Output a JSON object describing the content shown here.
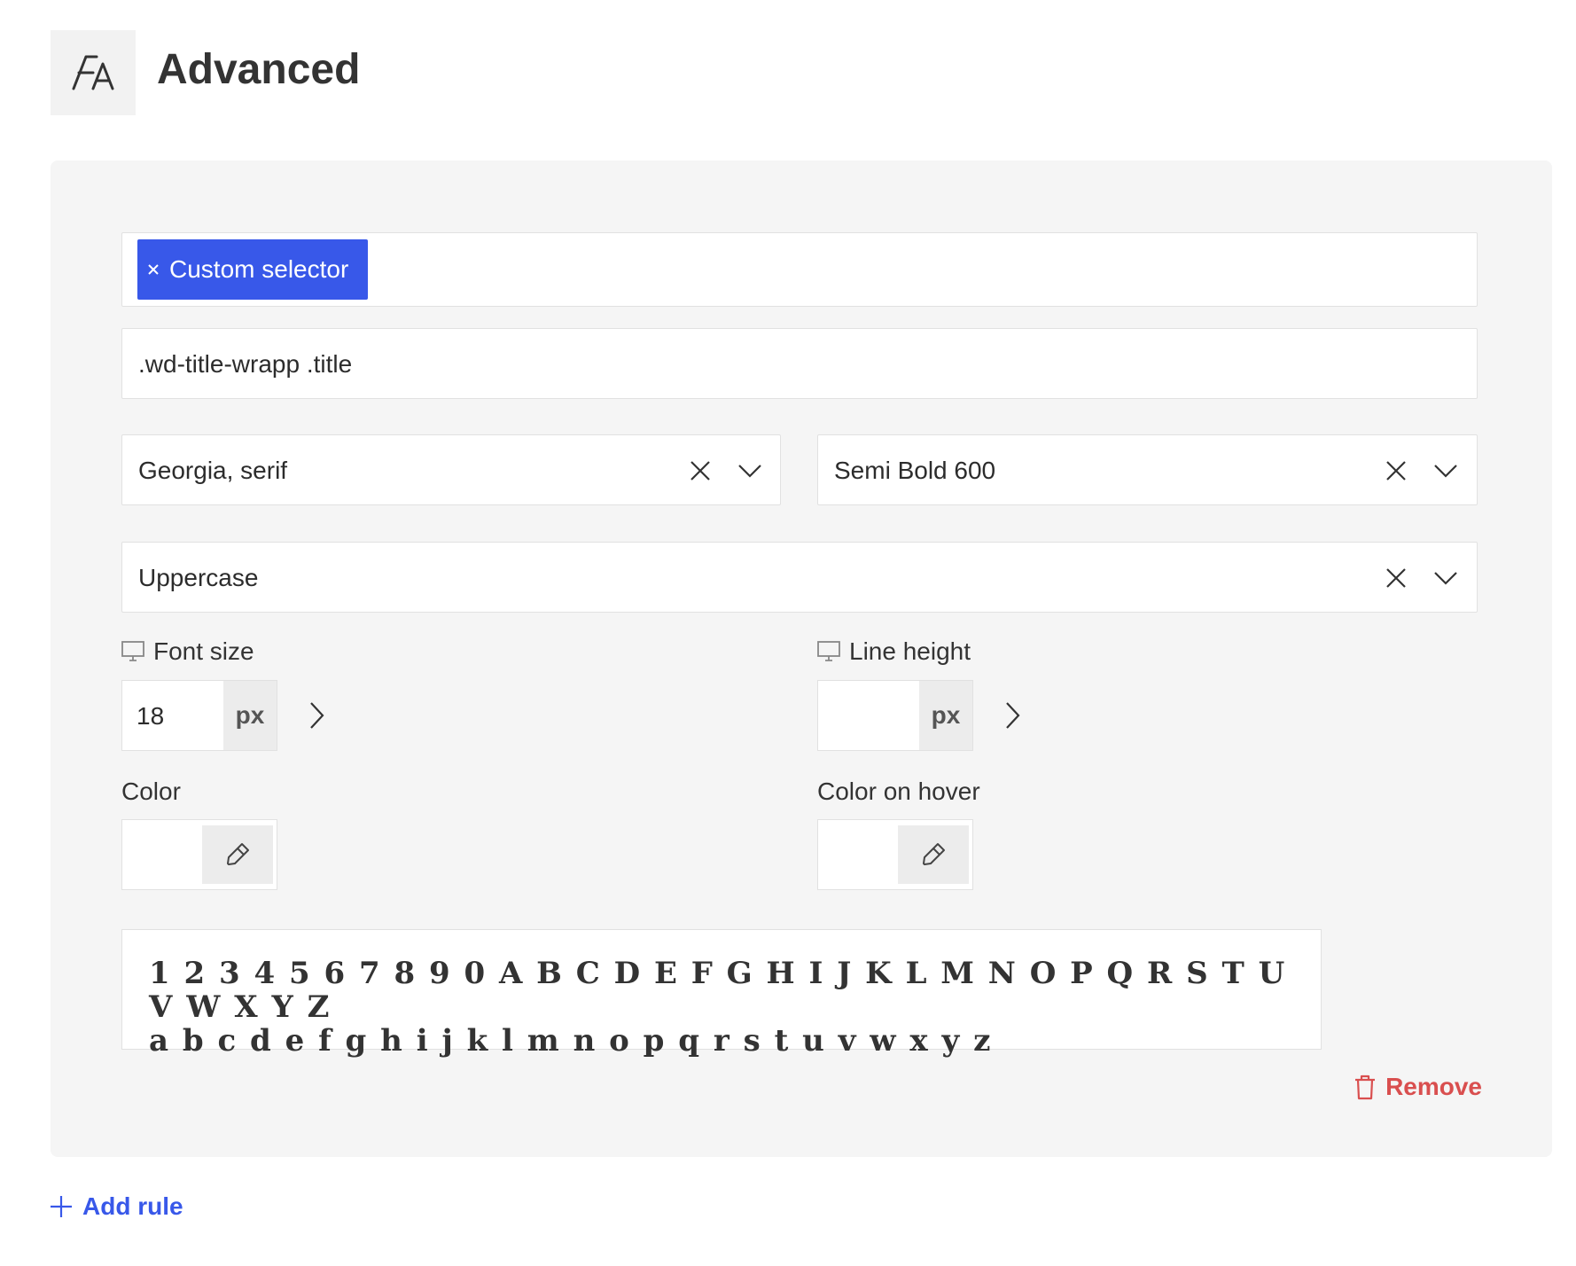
{
  "header": {
    "title": "Advanced",
    "icon": "typography-icon"
  },
  "rule": {
    "selector_chip_label": "Custom selector",
    "selector_value": ".wd-title-wrapp .title",
    "font_family": "Georgia, serif",
    "font_weight": "Semi Bold 600",
    "text_transform": "Uppercase",
    "font_size": {
      "label": "Font size",
      "value": "18",
      "unit": "px"
    },
    "line_height": {
      "label": "Line height",
      "value": "",
      "unit": "px"
    },
    "color": {
      "label": "Color"
    },
    "color_hover": {
      "label": "Color on hover"
    },
    "preview": {
      "line1": "1 2 3 4 5 6 7 8 9 0 A B C D E F G H I J K L M N O P Q R S T U V W X Y Z",
      "line2": "a b c d e f g h i j k l m n o p q r s t u v w x y z"
    },
    "remove_label": "Remove"
  },
  "footer": {
    "add_rule_label": "Add rule"
  },
  "colors": {
    "accent": "#3858e9",
    "danger": "#d94f4f",
    "panel_bg": "#f5f5f5"
  }
}
